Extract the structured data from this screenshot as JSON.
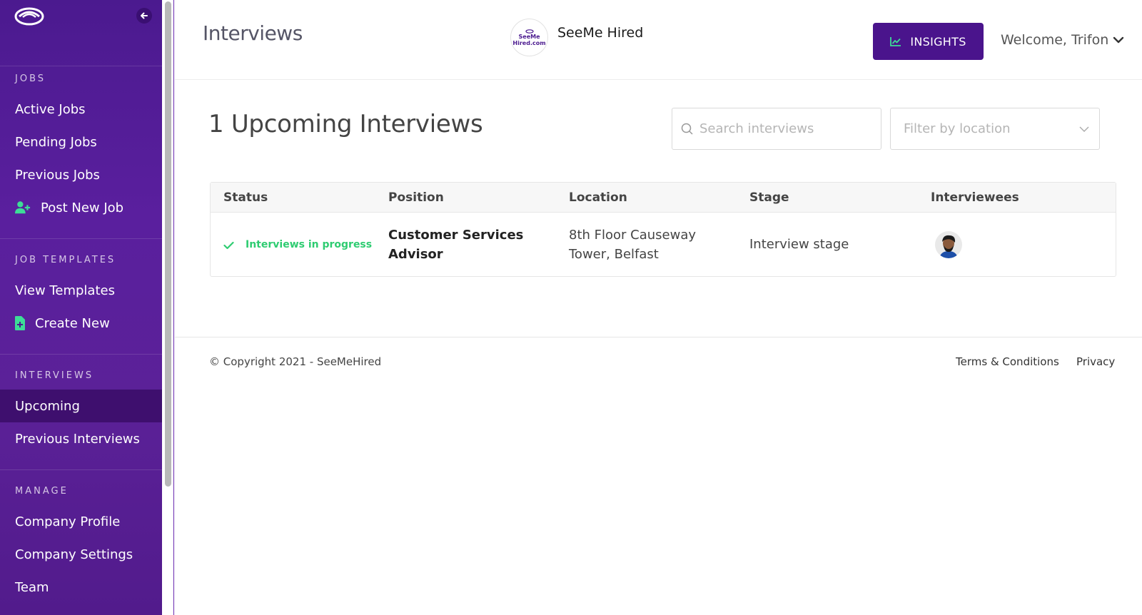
{
  "sidebar": {
    "logo": "seemehired-eye-logo",
    "collapse_icon": "arrow-left-icon",
    "sections": [
      {
        "heading": "JOBS",
        "items": [
          {
            "label": "Active Jobs"
          },
          {
            "label": "Pending Jobs"
          },
          {
            "label": "Previous Jobs"
          },
          {
            "label": "Post New Job",
            "icon": "user-plus-icon"
          }
        ]
      },
      {
        "heading": "JOB TEMPLATES",
        "items": [
          {
            "label": "View Templates"
          },
          {
            "label": "Create New",
            "icon": "file-plus-icon"
          }
        ]
      },
      {
        "heading": "INTERVIEWS",
        "items": [
          {
            "label": "Upcoming",
            "active": true
          },
          {
            "label": "Previous Interviews"
          }
        ]
      },
      {
        "heading": "MANAGE",
        "items": [
          {
            "label": "Company Profile"
          },
          {
            "label": "Company Settings"
          },
          {
            "label": "Team"
          }
        ]
      }
    ]
  },
  "header": {
    "title": "Interviews",
    "company_logo_text": [
      "SeeMe",
      "Hired.com"
    ],
    "company_name": "SeeMe Hired",
    "insights_label": "INSIGHTS",
    "welcome": "Welcome, Trifon"
  },
  "main": {
    "title": "1 Upcoming Interviews",
    "search_placeholder": "Search interviews",
    "filter_placeholder": "Filter by location",
    "table": {
      "columns": [
        "Status",
        "Position",
        "Location",
        "Stage",
        "Interviewees"
      ],
      "rows": [
        {
          "status": "Interviews in progress",
          "position": [
            "Customer Services",
            "Advisor"
          ],
          "location": [
            "8th Floor Causeway",
            "Tower, Belfast"
          ],
          "stage": "Interview stage"
        }
      ]
    }
  },
  "footer": {
    "copyright": "© Copyright 2021 - SeeMeHired",
    "terms": "Terms & Conditions",
    "privacy": "Privacy"
  },
  "colors": {
    "sidebar": "#4b1a8f",
    "accent": "#4a148c",
    "success": "#2ecc71",
    "icon_green": "#3ddc97"
  }
}
